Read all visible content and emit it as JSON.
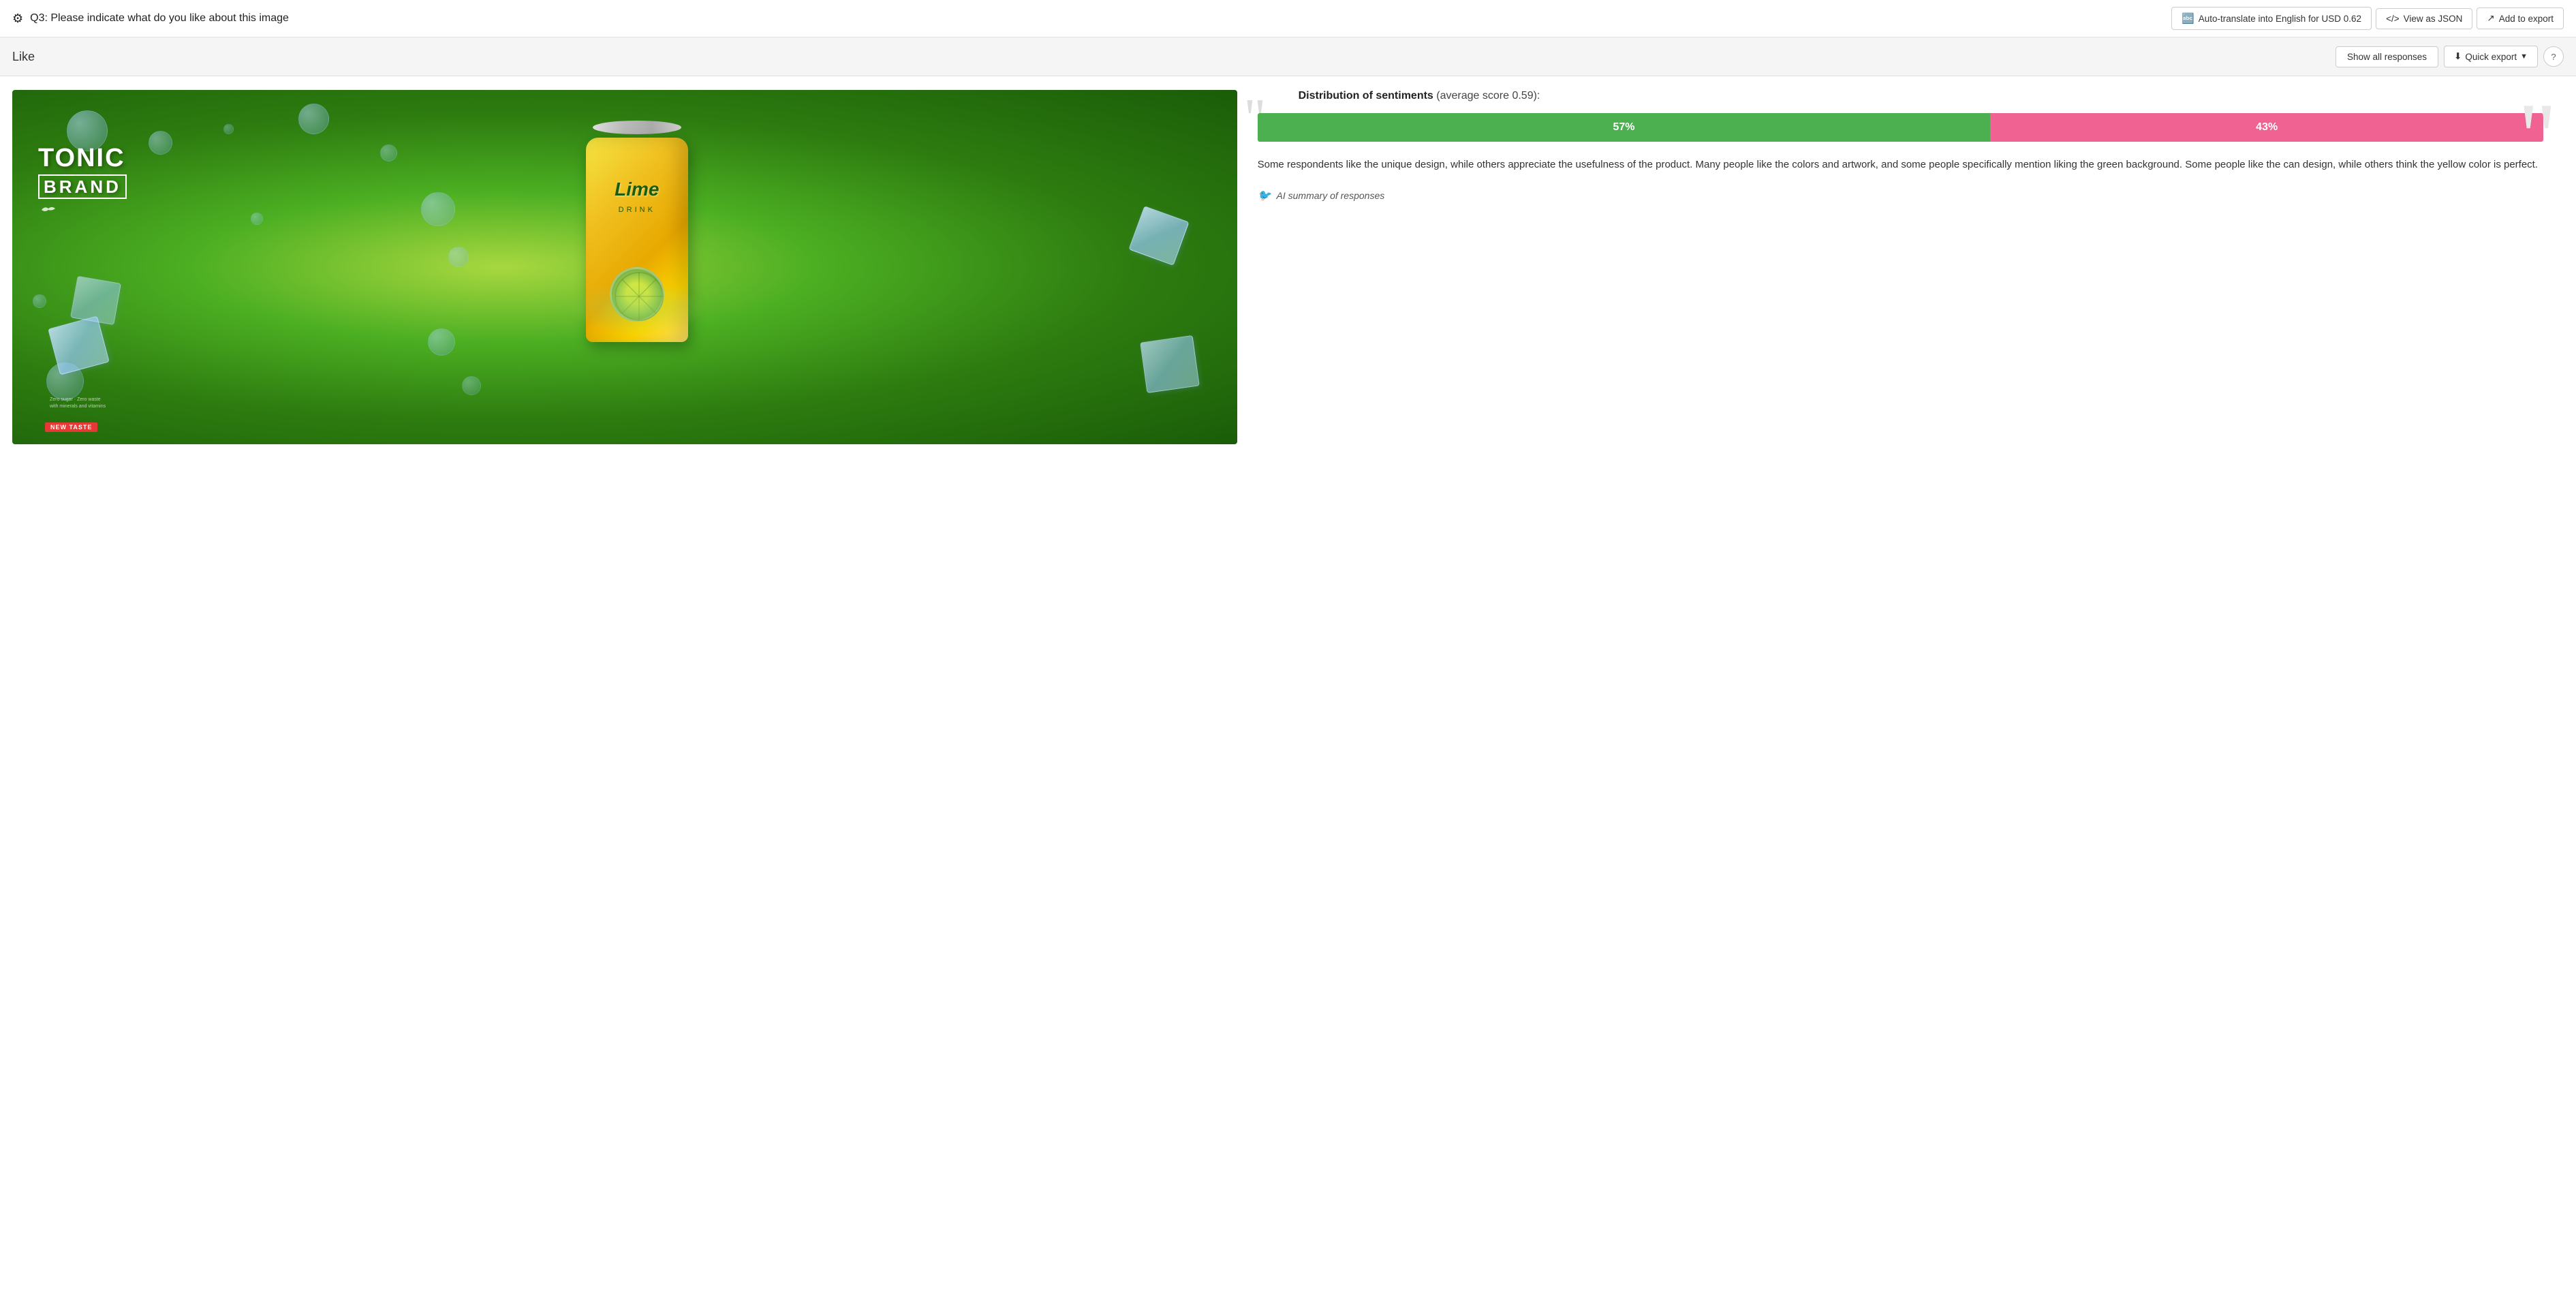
{
  "header": {
    "question_icon": "⚙",
    "question_label": "Q3: Please indicate what do you like about this image",
    "auto_translate_btn": "Auto-translate into English for USD 0.62",
    "view_json_btn": "View as JSON",
    "add_export_btn": "Add to export"
  },
  "subheader": {
    "section_label": "Like",
    "show_responses_btn": "Show all responses",
    "quick_export_btn": "Quick export",
    "help_btn": "?"
  },
  "image": {
    "tonic_brand_line1": "TONIC",
    "tonic_brand_line2": "BRAND",
    "can_lime_text": "Lime",
    "can_drink_text": "DRINK",
    "new_taste_badge": "NEW TASTE"
  },
  "sentiment": {
    "distribution_label": "Distribution of sentiments",
    "average_score_text": "(average score 0.59):",
    "positive_pct": "57%",
    "negative_pct": "43%",
    "positive_value": 57,
    "negative_value": 43,
    "description": "Some respondents like the unique design, while others appreciate the usefulness of the product. Many people like the colors and artwork, and some people specifically mention liking the green background. Some people like the can design, while others think the yellow color is perfect.",
    "ai_summary_label": "AI summary of responses"
  },
  "colors": {
    "positive_bar": "#4caf50",
    "negative_bar": "#f06292",
    "border": "#e0e0e0",
    "bg_subheader": "#f5f5f5"
  }
}
